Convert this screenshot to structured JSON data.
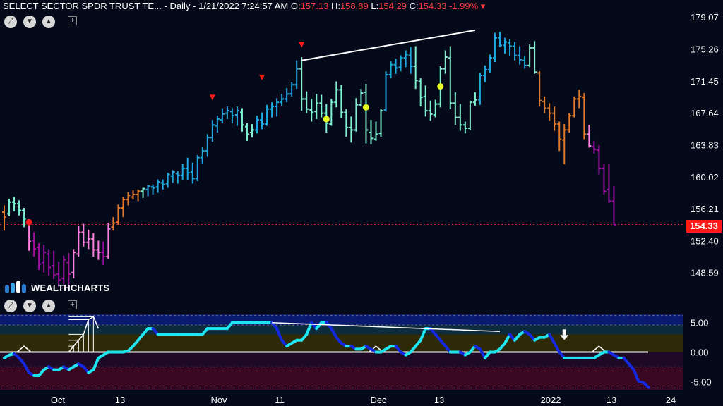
{
  "header": {
    "symbol": "SELECT SECTOR SPDR TRUST TE...",
    "interval": "Daily",
    "datetime": "1/21/2022 7:24:57 AM",
    "o_label": "O:",
    "o_value": "157.13",
    "h_label": "H:",
    "h_value": "158.89",
    "l_label": "L:",
    "l_value": "154.29",
    "c_label": "C:",
    "c_value": "154.33",
    "change": "-1.99%"
  },
  "logo": {
    "text": "WEALTHCHARTS"
  },
  "controls": {
    "icons": [
      "expand-icon",
      "chevron-down-icon",
      "chevron-up-icon",
      "add-icon"
    ]
  },
  "last_price_tag": "154.33",
  "colors": {
    "background": "#050a1a",
    "strong_up": "#1fa8e0",
    "weak_up": "#7ff0d0",
    "neutral_up": "#f0a050",
    "orange": "#e07a2a",
    "pink": "#ff80e0",
    "purple": "#a010a0",
    "price_line": "#ff2a2a",
    "oscillator_cyan": "#1ee6f0",
    "oscillator_blue": "#1428e0"
  },
  "chart_data": [
    {
      "type": "ohlc",
      "panel": "price",
      "y_ticks": [
        "179.07",
        "175.26",
        "171.45",
        "167.64",
        "163.83",
        "160.02",
        "156.21",
        "152.40",
        "148.59"
      ],
      "ylim": [
        146.8,
        180.1
      ],
      "last_price": 154.33,
      "x_ticks": [
        "Oct",
        "13",
        "Nov",
        "11",
        "Dec",
        "13",
        "2022",
        "13",
        "24"
      ],
      "bars_order": [
        "open",
        "high",
        "low",
        "close",
        "color"
      ],
      "bars": [
        [
          155.8,
          156.6,
          153.6,
          155.2,
          "o"
        ],
        [
          155.6,
          157.4,
          155.3,
          157.0,
          "w"
        ],
        [
          157.0,
          157.6,
          155.9,
          156.8,
          "w"
        ],
        [
          156.8,
          157.2,
          155.4,
          156.0,
          "w"
        ],
        [
          156.0,
          156.3,
          154.0,
          155.0,
          "w"
        ],
        [
          154.6,
          155.0,
          151.2,
          152.3,
          "p"
        ],
        [
          152.4,
          153.4,
          150.5,
          151.4,
          "v"
        ],
        [
          151.6,
          152.1,
          148.9,
          149.6,
          "v"
        ],
        [
          149.8,
          151.9,
          148.6,
          151.0,
          "v"
        ],
        [
          150.8,
          151.4,
          148.2,
          149.2,
          "v"
        ],
        [
          149.4,
          151.2,
          147.8,
          148.3,
          "v"
        ],
        [
          148.4,
          149.9,
          146.9,
          147.7,
          "v"
        ],
        [
          147.9,
          150.6,
          147.2,
          150.1,
          "v"
        ],
        [
          149.8,
          150.9,
          147.0,
          148.4,
          "v"
        ],
        [
          148.6,
          151.4,
          147.9,
          151.0,
          "p"
        ],
        [
          150.8,
          154.2,
          150.5,
          153.4,
          "p"
        ],
        [
          153.4,
          154.4,
          151.7,
          152.2,
          "p"
        ],
        [
          152.2,
          153.7,
          151.4,
          152.6,
          "p"
        ],
        [
          152.6,
          153.3,
          150.5,
          151.3,
          "p"
        ],
        [
          151.3,
          152.4,
          150.1,
          151.0,
          "p"
        ],
        [
          151.0,
          152.3,
          149.5,
          150.5,
          "v"
        ],
        [
          150.5,
          154.5,
          150.2,
          153.8,
          "p"
        ],
        [
          154.0,
          155.2,
          153.6,
          154.5,
          "o"
        ],
        [
          154.6,
          156.7,
          154.3,
          156.3,
          "o"
        ],
        [
          156.3,
          157.6,
          155.2,
          157.3,
          "o"
        ],
        [
          157.3,
          158.2,
          156.6,
          157.8,
          "o"
        ],
        [
          157.6,
          158.4,
          157.3,
          157.9,
          "o"
        ],
        [
          157.9,
          158.5,
          157.1,
          158.3,
          "o"
        ],
        [
          158.3,
          158.7,
          157.5,
          158.6,
          "w"
        ],
        [
          158.5,
          159.0,
          157.7,
          158.9,
          "s"
        ],
        [
          158.8,
          159.1,
          157.9,
          158.7,
          "s"
        ],
        [
          158.8,
          159.7,
          158.1,
          159.4,
          "s"
        ],
        [
          159.3,
          159.7,
          158.5,
          159.1,
          "s"
        ],
        [
          159.2,
          160.5,
          158.7,
          160.3,
          "s"
        ],
        [
          160.1,
          160.8,
          159.3,
          160.6,
          "s"
        ],
        [
          160.4,
          160.7,
          159.2,
          160.2,
          "s"
        ],
        [
          160.2,
          161.6,
          159.6,
          161.0,
          "s"
        ],
        [
          161.0,
          162.3,
          159.6,
          160.5,
          "s"
        ],
        [
          160.6,
          161.7,
          159.2,
          159.8,
          "s"
        ],
        [
          159.8,
          162.6,
          159.5,
          162.3,
          "s"
        ],
        [
          162.3,
          163.6,
          161.6,
          163.1,
          "s"
        ],
        [
          163.1,
          165.1,
          162.4,
          164.7,
          "s"
        ],
        [
          164.7,
          166.8,
          164.2,
          166.2,
          "s"
        ],
        [
          166.1,
          167.3,
          165.3,
          166.9,
          "s"
        ],
        [
          166.8,
          168.2,
          166.4,
          167.5,
          "s"
        ],
        [
          167.6,
          168.4,
          166.9,
          167.9,
          "s"
        ],
        [
          167.8,
          168.2,
          166.4,
          167.3,
          "s"
        ],
        [
          167.4,
          168.4,
          166.1,
          167.9,
          "s"
        ],
        [
          167.7,
          168.2,
          165.4,
          166.2,
          "w"
        ],
        [
          166.0,
          166.4,
          164.3,
          165.1,
          "w"
        ],
        [
          165.3,
          166.3,
          164.7,
          165.6,
          "w"
        ],
        [
          165.6,
          167.3,
          165.2,
          166.8,
          "s"
        ],
        [
          166.8,
          167.7,
          165.7,
          166.3,
          "s"
        ],
        [
          166.3,
          168.6,
          166.1,
          168.1,
          "s"
        ],
        [
          168.1,
          168.9,
          167.1,
          168.4,
          "s"
        ],
        [
          168.4,
          169.4,
          167.2,
          168.9,
          "s"
        ],
        [
          168.9,
          169.9,
          168.5,
          169.3,
          "s"
        ],
        [
          169.3,
          170.6,
          168.9,
          169.9,
          "s"
        ],
        [
          169.9,
          171.3,
          169.6,
          171.0,
          "s"
        ],
        [
          171.0,
          173.9,
          170.5,
          172.9,
          "s"
        ],
        [
          172.9,
          174.3,
          167.9,
          169.3,
          "w"
        ],
        [
          169.3,
          170.2,
          167.6,
          168.1,
          "w"
        ],
        [
          168.0,
          169.3,
          166.6,
          167.7,
          "w"
        ],
        [
          167.8,
          169.9,
          166.9,
          168.8,
          "w"
        ],
        [
          168.8,
          169.8,
          167.1,
          167.6,
          "w"
        ],
        [
          167.6,
          168.7,
          165.3,
          166.4,
          "w"
        ],
        [
          166.3,
          169.3,
          166.1,
          168.9,
          "w"
        ],
        [
          168.9,
          171.4,
          168.3,
          170.4,
          "w"
        ],
        [
          170.4,
          171.0,
          167.0,
          167.7,
          "w"
        ],
        [
          167.7,
          168.1,
          164.8,
          165.9,
          "w"
        ],
        [
          165.9,
          167.2,
          164.1,
          165.6,
          "w"
        ],
        [
          165.6,
          169.4,
          165.4,
          168.6,
          "w"
        ],
        [
          168.6,
          170.5,
          168.4,
          170.0,
          "w"
        ],
        [
          170.1,
          171.1,
          164.0,
          165.6,
          "w"
        ],
        [
          165.3,
          166.8,
          163.9,
          164.6,
          "w"
        ],
        [
          164.5,
          166.6,
          164.3,
          165.1,
          "w"
        ],
        [
          165.2,
          168.1,
          164.8,
          167.9,
          "w"
        ],
        [
          168.0,
          172.6,
          167.8,
          172.2,
          "s"
        ],
        [
          172.2,
          173.8,
          171.8,
          173.4,
          "s"
        ],
        [
          173.4,
          174.1,
          172.3,
          173.0,
          "s"
        ],
        [
          173.1,
          174.5,
          172.6,
          174.2,
          "s"
        ],
        [
          174.2,
          175.1,
          173.1,
          174.6,
          "s"
        ],
        [
          174.5,
          175.5,
          172.3,
          173.2,
          "s"
        ],
        [
          173.2,
          175.6,
          170.5,
          171.5,
          "w"
        ],
        [
          171.4,
          171.8,
          168.4,
          169.5,
          "w"
        ],
        [
          169.6,
          170.9,
          167.2,
          167.9,
          "w"
        ],
        [
          167.9,
          169.1,
          166.7,
          167.5,
          "w"
        ],
        [
          167.4,
          169.2,
          167.1,
          168.7,
          "w"
        ],
        [
          168.7,
          173.2,
          168.3,
          172.9,
          "w"
        ],
        [
          172.9,
          175.1,
          172.3,
          174.3,
          "w"
        ],
        [
          174.2,
          175.6,
          168.1,
          168.8,
          "w"
        ],
        [
          168.8,
          170.1,
          166.2,
          167.1,
          "w"
        ],
        [
          167.1,
          168.7,
          165.5,
          166.2,
          "w"
        ],
        [
          166.2,
          166.6,
          165.2,
          165.8,
          "w"
        ],
        [
          165.8,
          169.1,
          165.6,
          168.9,
          "w"
        ],
        [
          168.9,
          170.1,
          168.5,
          169.2,
          "w"
        ],
        [
          169.2,
          172.4,
          168.6,
          172.1,
          "s"
        ],
        [
          172.1,
          173.3,
          171.3,
          172.8,
          "s"
        ],
        [
          172.8,
          174.6,
          172.4,
          174.2,
          "s"
        ],
        [
          174.2,
          177.2,
          173.7,
          176.6,
          "s"
        ],
        [
          176.6,
          177.3,
          175.5,
          175.7,
          "s"
        ],
        [
          175.7,
          176.6,
          174.7,
          176.1,
          "s"
        ],
        [
          176.0,
          176.4,
          174.4,
          175.6,
          "s"
        ],
        [
          175.6,
          176.1,
          173.9,
          174.5,
          "s"
        ],
        [
          174.5,
          175.6,
          173.4,
          174.0,
          "s"
        ],
        [
          173.9,
          174.4,
          172.9,
          173.3,
          "s"
        ],
        [
          173.3,
          175.8,
          173.1,
          175.4,
          "w"
        ],
        [
          175.4,
          176.2,
          172.3,
          172.5,
          "w"
        ],
        [
          172.4,
          172.6,
          168.4,
          169.1,
          "o"
        ],
        [
          169.0,
          169.6,
          167.6,
          168.2,
          "o"
        ],
        [
          168.2,
          168.8,
          166.7,
          167.6,
          "o"
        ],
        [
          167.6,
          168.4,
          165.5,
          166.3,
          "o"
        ],
        [
          166.3,
          166.6,
          163.1,
          164.5,
          "o"
        ],
        [
          164.4,
          166.3,
          161.5,
          165.6,
          "o"
        ],
        [
          165.6,
          167.6,
          165.3,
          167.3,
          "o"
        ],
        [
          167.3,
          169.6,
          167.1,
          169.3,
          "o"
        ],
        [
          169.3,
          170.4,
          168.2,
          169.6,
          "o"
        ],
        [
          169.5,
          170.0,
          164.5,
          165.1,
          "o"
        ],
        [
          165.1,
          166.2,
          163.5,
          163.7,
          "p"
        ],
        [
          163.6,
          164.3,
          162.8,
          163.3,
          "v"
        ],
        [
          163.2,
          163.8,
          160.3,
          161.0,
          "v"
        ],
        [
          161.0,
          161.6,
          157.9,
          158.3,
          "v"
        ],
        [
          158.5,
          161.6,
          156.9,
          157.1,
          "v"
        ],
        [
          157.1,
          158.9,
          154.3,
          154.3,
          "v"
        ]
      ],
      "signals": {
        "down_triangles": [
          [
            42,
            168.8
          ],
          [
            52,
            171.2
          ],
          [
            60,
            175.1
          ]
        ],
        "yellow_dots": [
          [
            65,
            166.9
          ],
          [
            73,
            168.3
          ],
          [
            88,
            170.8
          ]
        ],
        "red_dots": [
          [
            5,
            154.6
          ]
        ]
      },
      "trendline": [
        [
          60,
          173.9
        ],
        [
          95,
          177.5
        ]
      ]
    },
    {
      "type": "line",
      "panel": "oscillator",
      "y_ticks": [
        "5.00",
        "0.00",
        "-5.00"
      ],
      "ylim": [
        -6.4,
        6.4
      ],
      "series": [
        {
          "values": [
            -1,
            -0.5,
            -0.3,
            -1,
            -2,
            -3.5,
            -4,
            -4,
            -3,
            -2.5,
            -3,
            -3,
            -2.5,
            -3,
            -2.5,
            -2,
            -2.5,
            -3.5,
            -3,
            -1,
            -0.5,
            0,
            0,
            0,
            0,
            0.2,
            1,
            2,
            3,
            4,
            4,
            3,
            3,
            3,
            3,
            3,
            3,
            3,
            3,
            3,
            3,
            4,
            4,
            4,
            4,
            4,
            5,
            5,
            5,
            5,
            5,
            5,
            5,
            5,
            5,
            4,
            2,
            1,
            1.5,
            2,
            2,
            3,
            5,
            4,
            5,
            5,
            4,
            2.5,
            1.5,
            1,
            1,
            0.5,
            0.5,
            1,
            0.5,
            0,
            0,
            0.5,
            1,
            1,
            0,
            -0.5,
            0,
            1,
            2,
            4,
            4,
            3,
            2,
            1,
            0,
            0,
            0,
            -0.5,
            0,
            1,
            0.5,
            -1,
            0,
            0,
            0.5,
            1.5,
            3,
            2,
            3,
            3.5,
            3,
            2,
            2.5,
            2.5,
            3,
            1.5,
            0,
            -1,
            -1,
            -1,
            -1,
            -1,
            -1,
            -1,
            -0.5,
            0,
            0,
            -0.5,
            -1,
            -1,
            -2,
            -3,
            -5,
            -5.2,
            -6
          ]
        }
      ],
      "white_ladder": [
        [
          13,
          0
        ],
        [
          14,
          1
        ],
        [
          15,
          2
        ],
        [
          16,
          3
        ],
        [
          17,
          5.5
        ],
        [
          18,
          6
        ],
        [
          19,
          4
        ]
      ],
      "white_arrow": [
        113,
        0.5
      ],
      "trendline": [
        [
          54,
          5
        ],
        [
          100,
          3.5
        ]
      ]
    }
  ]
}
